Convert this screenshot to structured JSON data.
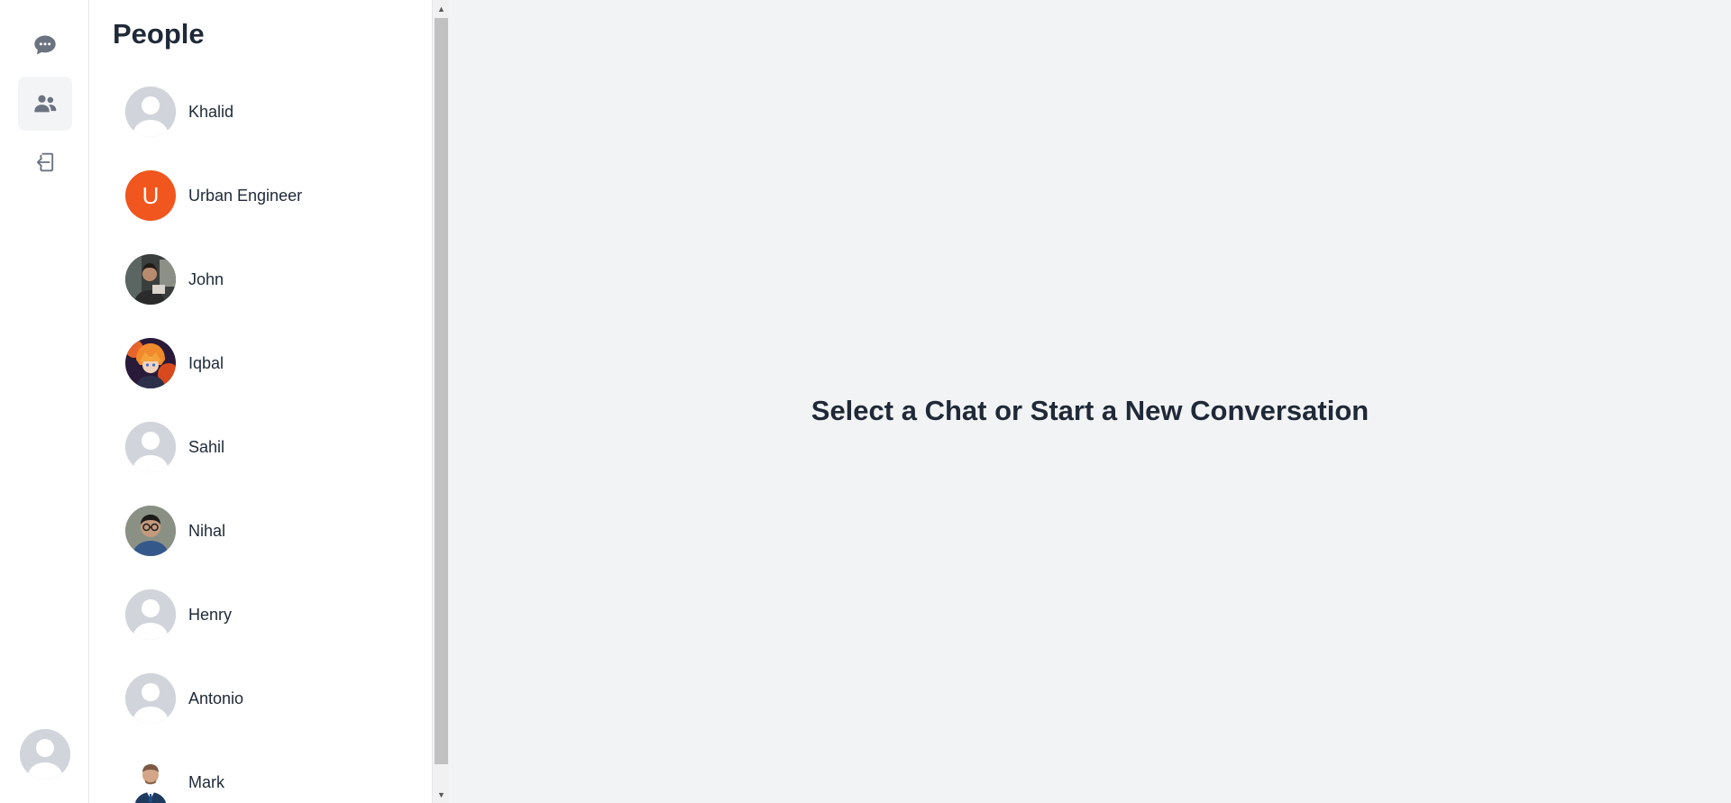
{
  "rail": {
    "items": [
      {
        "name": "chats",
        "icon": "chat-bubble-icon"
      },
      {
        "name": "people",
        "icon": "users-icon",
        "active": true
      },
      {
        "name": "logout",
        "icon": "sign-in-icon"
      }
    ],
    "profile_icon": "user-avatar"
  },
  "people": {
    "title": "People",
    "list": [
      {
        "name": "Khalid",
        "avatar": "default"
      },
      {
        "name": "Urban Engineer",
        "avatar": "letter",
        "letter": "U"
      },
      {
        "name": "John",
        "avatar": "photo"
      },
      {
        "name": "Iqbal",
        "avatar": "photo"
      },
      {
        "name": "Sahil",
        "avatar": "default"
      },
      {
        "name": "Nihal",
        "avatar": "photo"
      },
      {
        "name": "Henry",
        "avatar": "default"
      },
      {
        "name": "Antonio",
        "avatar": "default"
      },
      {
        "name": "Mark",
        "avatar": "photo"
      }
    ]
  },
  "main": {
    "message": "Select a Chat or Start a New Conversation"
  },
  "colors": {
    "accent_letter_avatar": "#f0561d",
    "main_background": "#f2f3f5",
    "active_rail": "#f3f4f6"
  }
}
